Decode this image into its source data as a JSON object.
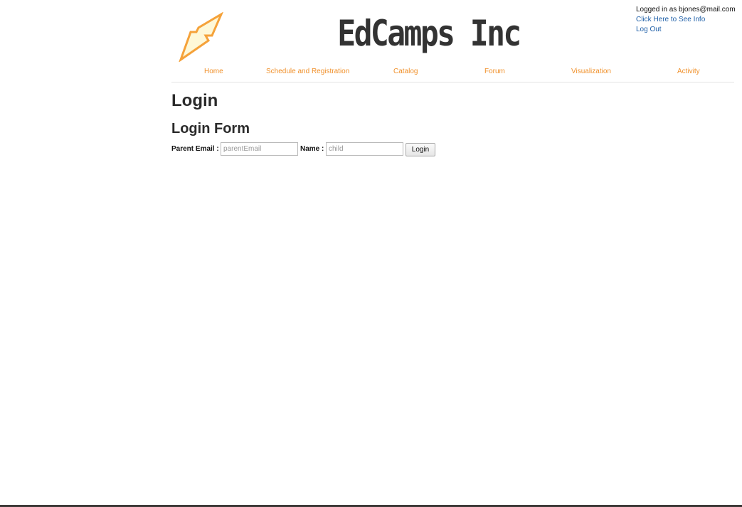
{
  "header": {
    "site_title": "EdCamps Inc",
    "logo_icon": "lightning-bolt-icon",
    "brand_color": "#f0902a"
  },
  "user_box": {
    "status": "Logged in as bjones@mail.com",
    "info_link": "Click Here to See Info",
    "logout_link": "Log Out"
  },
  "nav": {
    "items": [
      {
        "label": "Home"
      },
      {
        "label": "Schedule and Registration"
      },
      {
        "label": "Catalog"
      },
      {
        "label": "Forum"
      },
      {
        "label": "Visualization"
      },
      {
        "label": "Activity"
      }
    ]
  },
  "main": {
    "heading": "Login",
    "form_heading": "Login Form",
    "form": {
      "email_label": "Parent Email :",
      "email_placeholder": "parentEmail",
      "email_value": "",
      "name_label": "Name :",
      "name_placeholder": "child",
      "name_value": "",
      "submit_label": "Login"
    }
  }
}
